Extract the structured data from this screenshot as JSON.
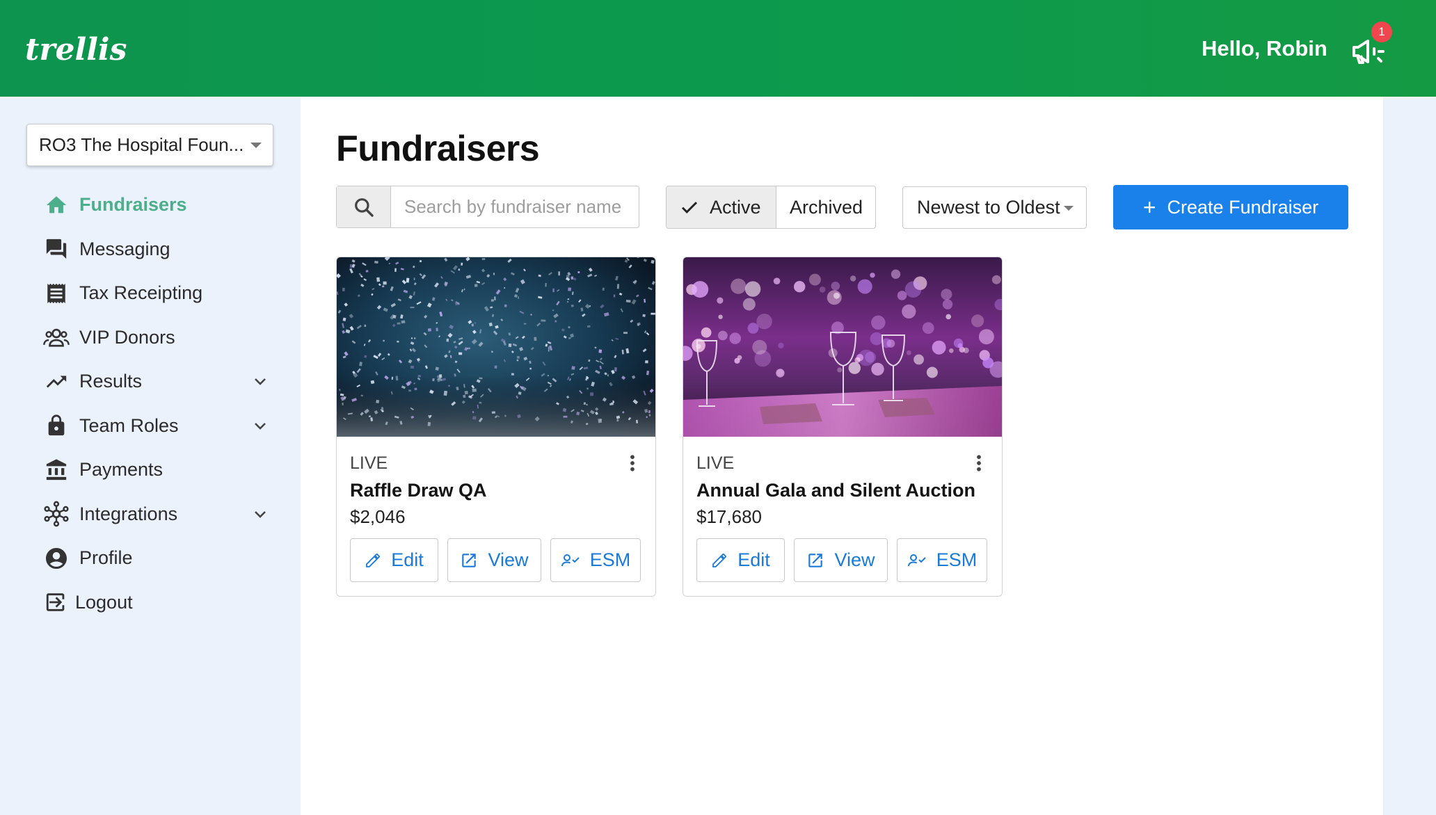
{
  "header": {
    "logo": "trellis",
    "greeting": "Hello, Robin",
    "notification_count": "1"
  },
  "sidebar": {
    "org_select": "RO3 The Hospital Foun...",
    "items": [
      {
        "label": "Fundraisers",
        "icon": "home-icon",
        "active": true
      },
      {
        "label": "Messaging",
        "icon": "chat-icon"
      },
      {
        "label": "Tax Receipting",
        "icon": "receipt-icon"
      },
      {
        "label": "VIP Donors",
        "icon": "group-icon"
      },
      {
        "label": "Results",
        "icon": "trending-up-icon",
        "expandable": true
      },
      {
        "label": "Team Roles",
        "icon": "lock-icon",
        "expandable": true
      },
      {
        "label": "Payments",
        "icon": "bank-icon"
      },
      {
        "label": "Integrations",
        "icon": "hub-icon",
        "expandable": true
      },
      {
        "label": "Profile",
        "icon": "account-circle-icon"
      },
      {
        "label": "Logout",
        "icon": "logout-icon"
      }
    ]
  },
  "main": {
    "title": "Fundraisers",
    "search_placeholder": "Search by fundraiser name",
    "filter": {
      "active_label": "Active",
      "archived_label": "Archived",
      "selected": "Active"
    },
    "sort_label": "Newest to Oldest",
    "create_label": "Create Fundraiser",
    "cards": [
      {
        "status": "LIVE",
        "name": "Raffle Draw QA",
        "amount": "$2,046",
        "image": "confetti-photo",
        "edit": "Edit",
        "view": "View",
        "esm": "ESM"
      },
      {
        "status": "LIVE",
        "name": "Annual Gala and Silent Auction",
        "amount": "$17,680",
        "image": "gala-table-photo",
        "edit": "Edit",
        "view": "View",
        "esm": "ESM"
      }
    ]
  },
  "colors": {
    "header_green": "#0d944e",
    "active_nav": "#4dae8c",
    "primary_blue": "#1a81ea",
    "badge_red": "#f0474e",
    "sidebar_bg": "#ebf2fc"
  }
}
